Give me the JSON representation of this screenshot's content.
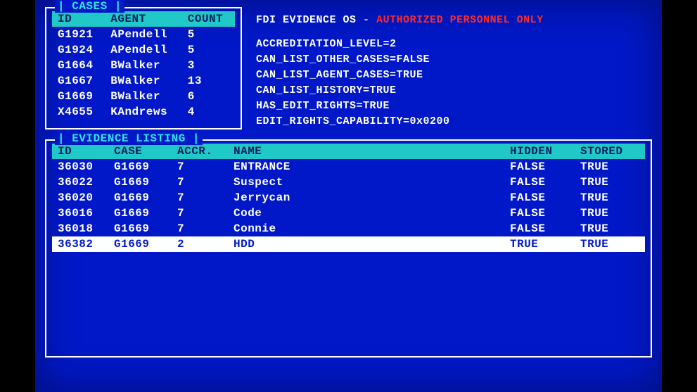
{
  "cases_panel": {
    "title": "| CASES |",
    "columns": {
      "id": "ID",
      "agent": "AGENT",
      "count": "COUNT"
    },
    "rows": [
      {
        "id": "G1921",
        "agent": "APendell",
        "count": "5"
      },
      {
        "id": "G1924",
        "agent": "APendell",
        "count": "5"
      },
      {
        "id": "G1664",
        "agent": "BWalker",
        "count": "3"
      },
      {
        "id": "G1667",
        "agent": "BWalker",
        "count": "13"
      },
      {
        "id": "G1669",
        "agent": "BWalker",
        "count": "6"
      },
      {
        "id": "X4655",
        "agent": "KAndrews",
        "count": "4"
      }
    ]
  },
  "system": {
    "app_name": "FDI EVIDENCE OS",
    "warning": "AUTHORIZED PERSONNEL ONLY",
    "lines": [
      "ACCREDITATION_LEVEL=2",
      "CAN_LIST_OTHER_CASES=FALSE",
      "CAN_LIST_AGENT_CASES=TRUE",
      "CAN_LIST_HISTORY=TRUE",
      "HAS_EDIT_RIGHTS=TRUE",
      "EDIT_RIGHTS_CAPABILITY=0x0200"
    ]
  },
  "evidence_panel": {
    "title": "| EVIDENCE LISTING |",
    "columns": {
      "id": "ID",
      "case": "CASE",
      "accr": "ACCR.",
      "name": "NAME",
      "hidden": "HIDDEN",
      "stored": "STORED"
    },
    "rows": [
      {
        "id": "36030",
        "case": "G1669",
        "accr": "7",
        "name": "ENTRANCE",
        "hidden": "FALSE",
        "stored": "TRUE",
        "selected": false
      },
      {
        "id": "36022",
        "case": "G1669",
        "accr": "7",
        "name": "Suspect",
        "hidden": "FALSE",
        "stored": "TRUE",
        "selected": false
      },
      {
        "id": "36020",
        "case": "G1669",
        "accr": "7",
        "name": "Jerrycan",
        "hidden": "FALSE",
        "stored": "TRUE",
        "selected": false
      },
      {
        "id": "36016",
        "case": "G1669",
        "accr": "7",
        "name": "Code",
        "hidden": "FALSE",
        "stored": "TRUE",
        "selected": false
      },
      {
        "id": "36018",
        "case": "G1669",
        "accr": "7",
        "name": "Connie",
        "hidden": "FALSE",
        "stored": "TRUE",
        "selected": false
      },
      {
        "id": "36382",
        "case": "G1669",
        "accr": "2",
        "name": "HDD",
        "hidden": "TRUE",
        "stored": "TRUE",
        "selected": true
      }
    ]
  }
}
